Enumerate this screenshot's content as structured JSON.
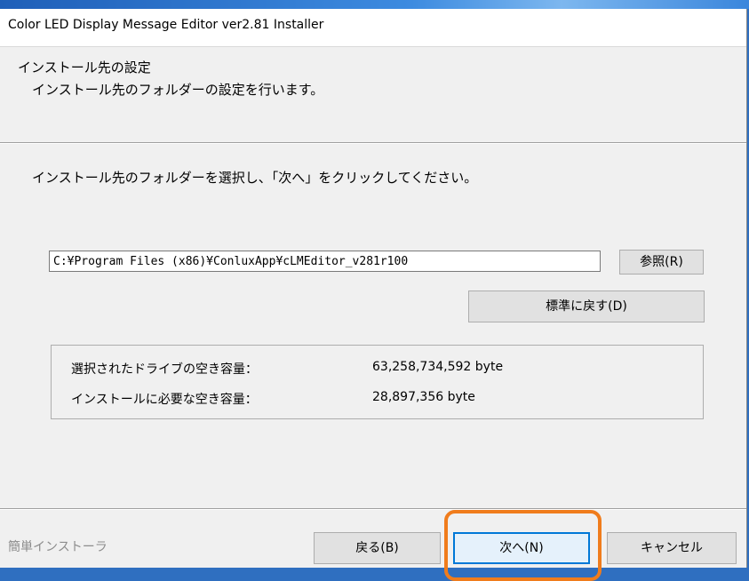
{
  "window": {
    "title": "Color LED Display Message Editor ver2.81 Installer"
  },
  "header": {
    "title": "インストール先の設定",
    "subtitle": "インストール先のフォルダーの設定を行います。"
  },
  "main": {
    "instruction": "インストール先のフォルダーを選択し、「次へ」をクリックしてください。",
    "install_path": "C:¥Program Files (x86)¥ConluxApp¥cLMEditor_v281r100",
    "browse_label": "参照(R)",
    "reset_default_label": "標準に戻す(D)",
    "space": {
      "free_label": "選択されたドライブの空き容量：",
      "free_value": "63,258,734,592 byte",
      "required_label": "インストールに必要な空き容量：",
      "required_value": "28,897,356 byte"
    }
  },
  "footer": {
    "brand_label": "簡単インストーラ",
    "back_label": "戻る(B)",
    "next_label": "次へ(N)",
    "cancel_label": "キャンセル"
  },
  "colors": {
    "highlight": "#f07c1c",
    "focus_border": "#0078d7"
  }
}
